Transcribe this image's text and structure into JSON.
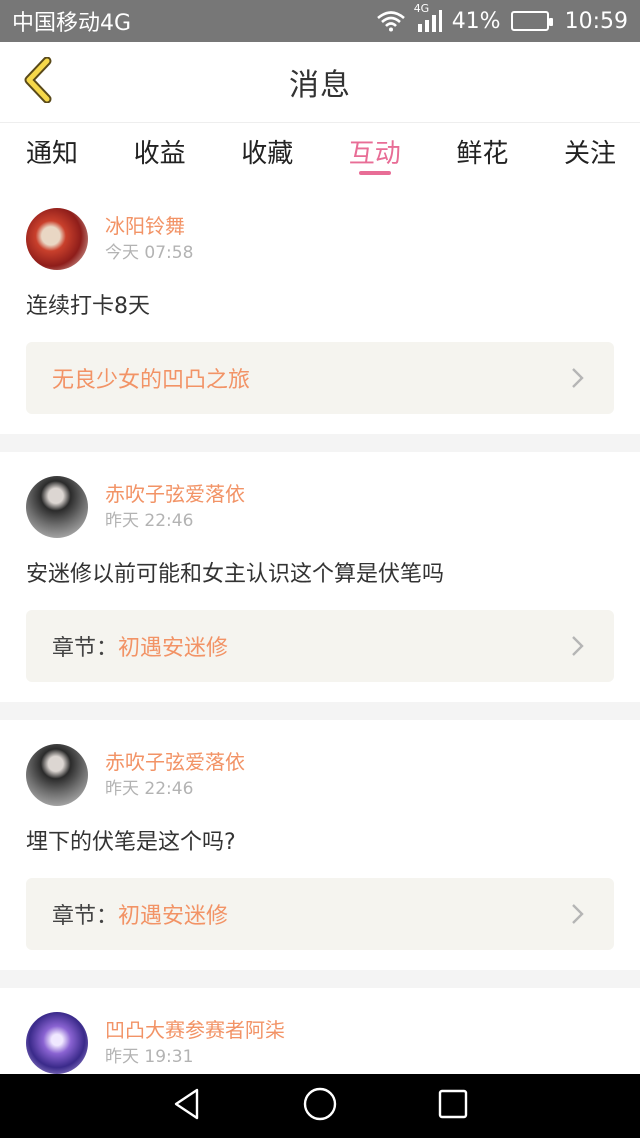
{
  "status_bar": {
    "carrier": "中国移动4G",
    "network_tag": "4G",
    "battery_text": "41%",
    "battery_level": 0.41,
    "time": "10:59"
  },
  "header": {
    "title": "消息"
  },
  "tabs": [
    {
      "label": "通知",
      "active": false
    },
    {
      "label": "收益",
      "active": false
    },
    {
      "label": "收藏",
      "active": false
    },
    {
      "label": "互动",
      "active": true
    },
    {
      "label": "鲜花",
      "active": false
    },
    {
      "label": "关注",
      "active": false
    }
  ],
  "colors": {
    "accent_pink": "#e86d96",
    "accent_orange": "#f29366"
  },
  "messages": [
    {
      "username": "冰阳铃舞",
      "time": "今天 07:58",
      "text": "连续打卡8天",
      "ref_prefix": "",
      "ref_title": "无良少女的凹凸之旅"
    },
    {
      "username": "赤吹子弦爱落依",
      "time": "昨天 22:46",
      "text": "安迷修以前可能和女主认识这个算是伏笔吗",
      "ref_prefix": "章节：",
      "ref_title": "初遇安迷修"
    },
    {
      "username": "赤吹子弦爱落依",
      "time": "昨天 22:46",
      "text": "埋下的伏笔是这个吗?",
      "ref_prefix": "章节：",
      "ref_title": "初遇安迷修"
    },
    {
      "username": "凹凸大赛参赛者阿柒",
      "time": "昨天 19:31"
    }
  ]
}
